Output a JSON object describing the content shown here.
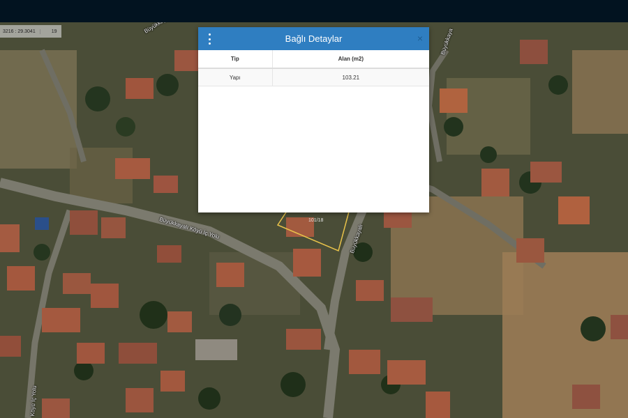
{
  "coordinates": {
    "value": "3216 : 29.3041",
    "zoom": "19"
  },
  "map": {
    "road_labels": [
      "Büyükkayalı Köyü",
      "Büyükkayalı Köyü İç Yolu",
      "Büyükkaya",
      "Büyükkayalı",
      "Köyü İç Yolu"
    ],
    "parcel_label": "101/18",
    "parcel_color": "#e8c24a"
  },
  "modal": {
    "title": "Bağlı Detaylar",
    "close_symbol": "×",
    "header_color": "#2f7ec1",
    "columns": [
      "Tip",
      "Alan (m2)"
    ],
    "rows": [
      [
        "Yapı",
        "103.21"
      ]
    ]
  }
}
